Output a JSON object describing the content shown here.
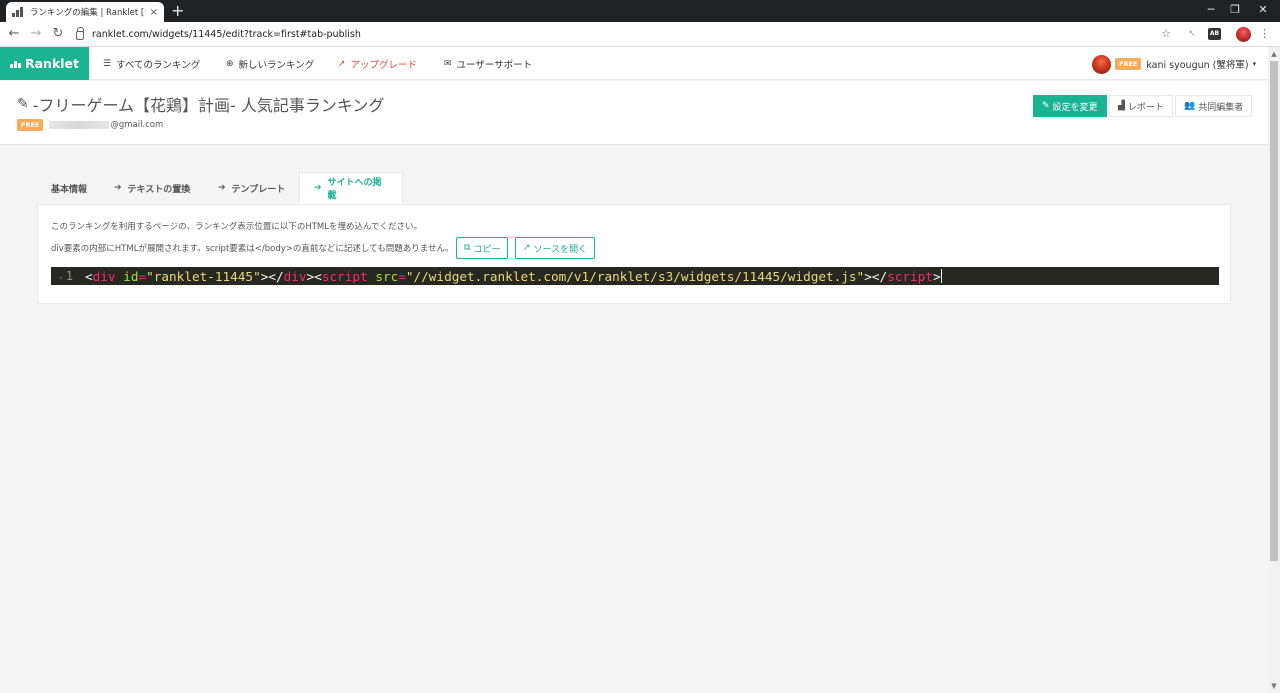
{
  "browser": {
    "tab_title": "ランキングの編集 | Ranklet [ランクレット]",
    "tab_close": "×",
    "new_tab": "+",
    "url": "ranklet.com/widgets/11445/edit?track=first#tab-publish",
    "ext_badge": "AB",
    "win_min": "─",
    "win_max": "❐",
    "win_close": "✕"
  },
  "appnav": {
    "brand": "Ranklet",
    "items": [
      {
        "icon": "☰",
        "label": "すべてのランキング"
      },
      {
        "icon": "⊕",
        "label": "新しいランキング"
      },
      {
        "icon": "➚",
        "label": "アップグレード"
      },
      {
        "icon": "✉",
        "label": "ユーザーサポート"
      }
    ],
    "user": {
      "badge": "FREE",
      "name": "kani syougun (蟹将軍)",
      "caret": "▾"
    }
  },
  "heading": {
    "title": "-フリーゲーム【花鶏】計画- 人気記事ランキング",
    "owner_badge": "FREE",
    "owner_email_suffix": "@gmail.com",
    "buttons": [
      {
        "icon": "✎",
        "label": "設定を変更"
      },
      {
        "icon": "▟",
        "label": "レポート"
      },
      {
        "icon": "👥",
        "label": "共同編集者"
      }
    ]
  },
  "tabs": [
    {
      "icon": "",
      "label": "基本情報"
    },
    {
      "icon": "➔",
      "label": "テキストの置換"
    },
    {
      "icon": "➔",
      "label": "テンプレート"
    },
    {
      "icon": "➔",
      "label": "サイトへの掲載"
    }
  ],
  "panel": {
    "desc1": "このランキングを利用するページの、ランキング表示位置に以下のHTMLを埋め込んでください。",
    "desc2": "div要素の内部にHTMLが展開されます。script要素は</body>の直前などに記述しても問題ありません。",
    "copy_icon": "⧉",
    "copy_label": "コピー",
    "open_icon": "↗",
    "open_label": "ソースを開く",
    "code": {
      "line": "1",
      "fold": "‹",
      "lt1": "<",
      "tag1": "div",
      "sp1": " ",
      "attr1": "id",
      "eq1": "=",
      "val1": "\"ranklet-11445\"",
      "gt1": "></",
      "tag2": "div",
      "gt2": "><",
      "tag3": "script",
      "sp2": " ",
      "attr2": "src",
      "eq2": "=",
      "val2": "\"//widget.ranklet.com/v1/ranklet/s3/widgets/11445/widget.js\"",
      "gt3": "></",
      "tag4": "script",
      "gt4": ">"
    }
  },
  "colors": {
    "brand": "#1ab394",
    "upgrade": "#e74c3c",
    "free_badge": "#f8ac59",
    "code_bg": "#272822"
  }
}
